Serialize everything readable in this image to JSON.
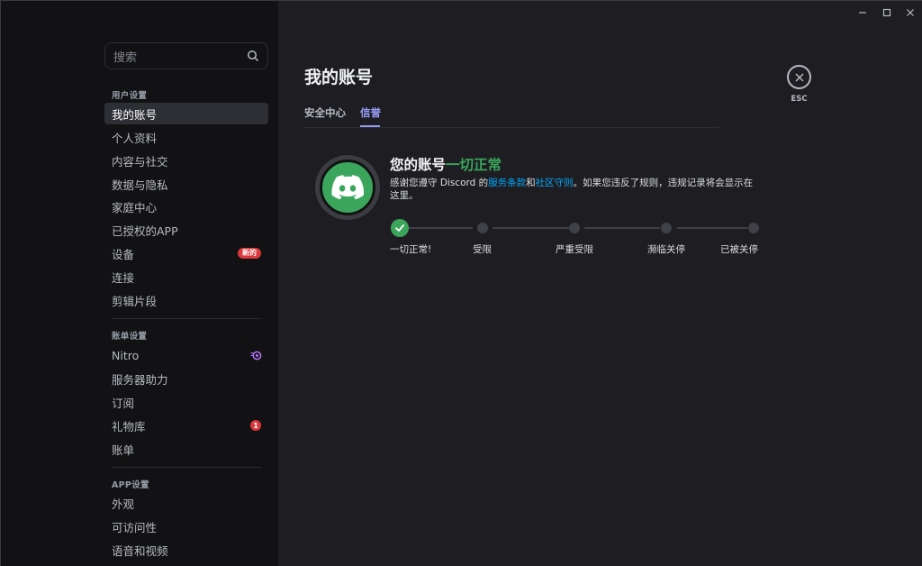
{
  "colors": {
    "sidebar_bg": "#121214",
    "main_bg": "#1e1e22",
    "active_item_bg": "#2e2f34",
    "accent_blurple": "#949cf7",
    "success_green": "#3ba55c",
    "badge_red": "#da373c",
    "link_blue": "#00a8fc"
  },
  "window_controls": {
    "minimize_icon": "minimize-icon",
    "maximize_icon": "maximize-icon",
    "close_icon": "close-icon"
  },
  "search": {
    "placeholder": "搜索",
    "icon": "search-icon"
  },
  "sidebar": {
    "user_settings": {
      "header": "用户设置",
      "items": [
        {
          "label": "我的账号",
          "active": true
        },
        {
          "label": "个人资料"
        },
        {
          "label": "内容与社交"
        },
        {
          "label": "数据与隐私"
        },
        {
          "label": "家庭中心"
        },
        {
          "label": "已授权的APP"
        },
        {
          "label": "设备",
          "badge": "新的"
        },
        {
          "label": "连接"
        },
        {
          "label": "剪辑片段"
        }
      ]
    },
    "billing_settings": {
      "header": "账单设置",
      "items": [
        {
          "label": "Nitro",
          "icon": "nitro-icon"
        },
        {
          "label": "服务器助力"
        },
        {
          "label": "订阅"
        },
        {
          "label": "礼物库",
          "count": "1"
        },
        {
          "label": "账单"
        }
      ]
    },
    "app_settings": {
      "header": "APP设置",
      "items": [
        {
          "label": "外观"
        },
        {
          "label": "可访问性"
        },
        {
          "label": "语音和视频"
        }
      ]
    }
  },
  "main": {
    "title": "我的账号",
    "tabs": [
      {
        "label": "安全中心"
      },
      {
        "label": "信誉",
        "active": true
      }
    ],
    "close_button": {
      "label": "ESC",
      "icon": "close-icon"
    },
    "standing": {
      "logo_icon": "discord-logo-icon",
      "title_prefix": "您的账号",
      "title_status": "一切正常",
      "desc_part1": "感谢您遵守 Discord 的",
      "desc_link1": "服务条款",
      "desc_part2": "和",
      "desc_link2": "社区守则",
      "desc_part3": "。如果您违反了规则，违规记录将会显示在这里。",
      "steps": [
        "一切正常!",
        "受限",
        "严重受限",
        "濒临关停",
        "已被关停"
      ],
      "current_step": 0
    }
  }
}
